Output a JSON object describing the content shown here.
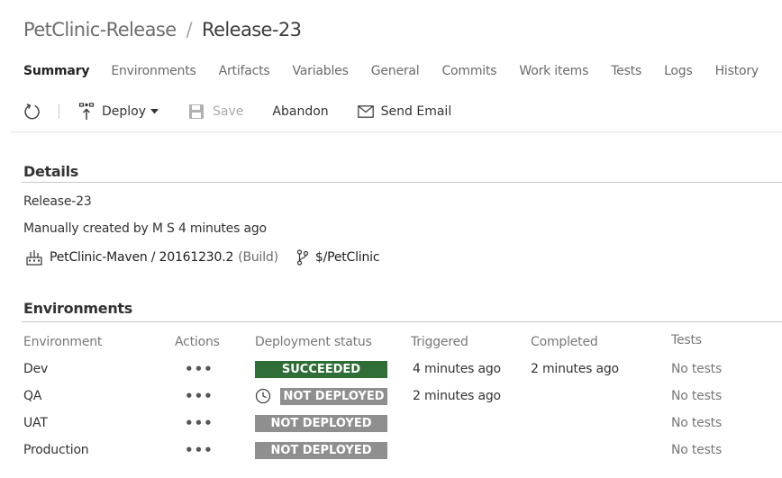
{
  "breadcrumb": {
    "parent": "PetClinic-Release",
    "separator": "/",
    "current": "Release-23"
  },
  "tabs": [
    {
      "label": "Summary",
      "active": true
    },
    {
      "label": "Environments"
    },
    {
      "label": "Artifacts"
    },
    {
      "label": "Variables"
    },
    {
      "label": "General"
    },
    {
      "label": "Commits"
    },
    {
      "label": "Work items"
    },
    {
      "label": "Tests"
    },
    {
      "label": "Logs"
    },
    {
      "label": "History"
    }
  ],
  "toolbar": {
    "refresh_icon": "refresh-icon",
    "deploy_label": "Deploy",
    "save_label": "Save",
    "abandon_label": "Abandon",
    "send_email_label": "Send Email"
  },
  "details": {
    "title": "Details",
    "release_name": "Release-23",
    "created_text": "Manually created by M S 4 minutes ago",
    "artifact_link": "PetClinic-Maven / 20161230.2",
    "artifact_type": "(Build)",
    "repo_path": "$/PetClinic"
  },
  "environments": {
    "title": "Environments",
    "columns": {
      "environment": "Environment",
      "actions": "Actions",
      "deployment_status": "Deployment status",
      "triggered": "Triggered",
      "completed": "Completed",
      "tests": "Tests"
    },
    "actions_glyph": "•••",
    "rows": [
      {
        "name": "Dev",
        "status": "SUCCEEDED",
        "status_color": "#2f6e36",
        "triggered": "4 minutes ago",
        "completed": "2 minutes ago",
        "tests": "No tests"
      },
      {
        "name": "QA",
        "status": "NOT DEPLOYED",
        "status_color": "#8f8f8f",
        "triggered": "2 minutes ago",
        "completed": "",
        "tests": "No tests",
        "pending_icon": "clock-icon"
      },
      {
        "name": "UAT",
        "status": "NOT DEPLOYED",
        "status_color": "#8f8f8f",
        "triggered": "",
        "completed": "",
        "tests": "No tests"
      },
      {
        "name": "Production",
        "status": "NOT DEPLOYED",
        "status_color": "#8f8f8f",
        "triggered": "",
        "completed": "",
        "tests": "No tests"
      }
    ]
  }
}
